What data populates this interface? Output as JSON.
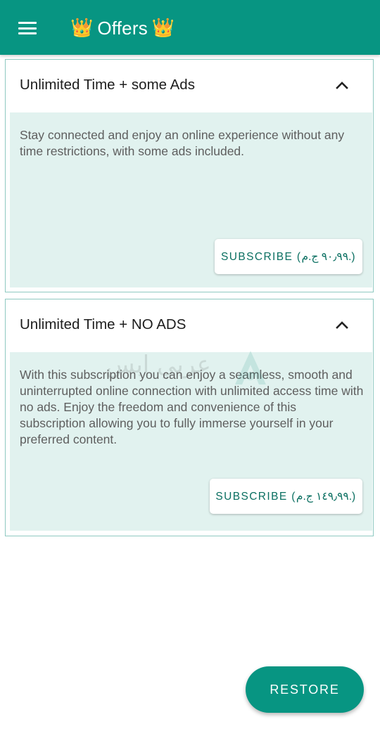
{
  "app_bar": {
    "title": "Offers",
    "title_icon": "crown-icon",
    "title_icon_char": "👑",
    "menu_icon": "hamburger-menu-icon",
    "background_color": "#079582"
  },
  "offers": [
    {
      "title": "Unlimited Time + some Ads",
      "expanded": true,
      "description": "Stay connected and enjoy an online experience without any time restrictions, with some ads included.",
      "subscribe_label": "SUBSCRIBE (٩٠٫٩٩ ج.م.)"
    },
    {
      "title": "Unlimited Time + NO ADS",
      "expanded": true,
      "description": "With this subscription you can enjoy a seamless, smooth and uninterrupted online connection with unlimited access time with no ads. Enjoy the freedom and convenience of this subscription allowing you to fully immerse yourself in your preferred content.",
      "subscribe_label": "SUBSCRIBE (١٤٩٫٩٩ ج.م.)"
    }
  ],
  "watermark": {
    "text": "عربي ابس"
  },
  "restore_label": "RESTORE",
  "colors": {
    "primary": "#079582",
    "card_body": "#e1f2ef",
    "card_border": "#8fc9c1",
    "button_text": "#0a6f61"
  }
}
